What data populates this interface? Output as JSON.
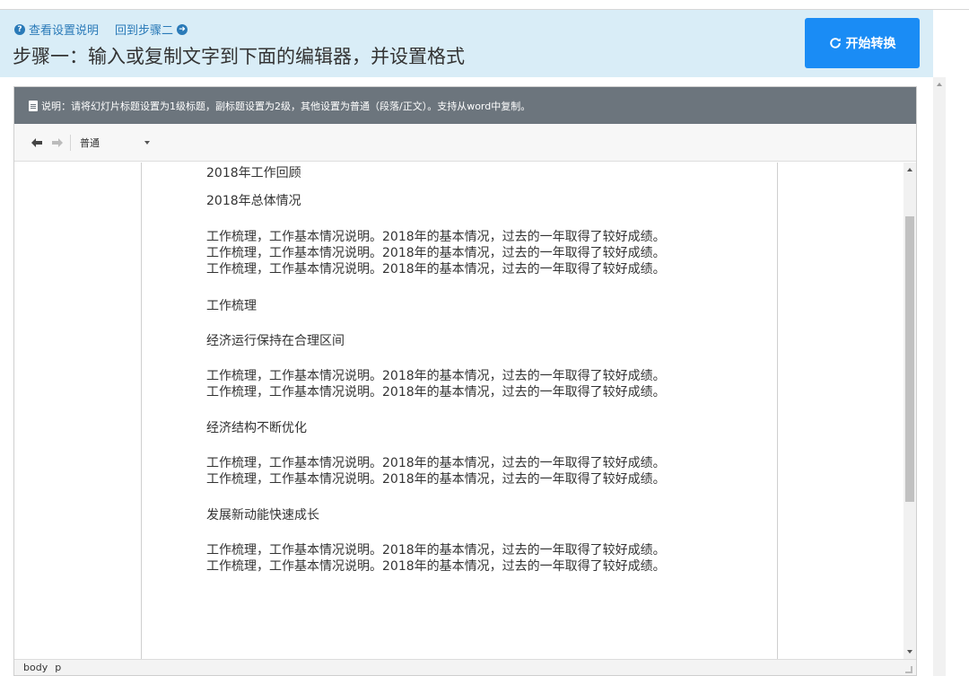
{
  "header": {
    "help_link": "查看设置说明",
    "back_link": "回到步骤二",
    "title": "步骤一：输入或复制文字到下面的编辑器，并设置格式",
    "convert_button": "开始转换",
    "background_color": "#d9edf7",
    "button_color": "#1a8cf5"
  },
  "editor": {
    "notice": "说明：请将幻灯片标题设置为1级标题，副标题设置为2级，其他设置为普通（段落/正文）。支持从word中复制。",
    "toolbar": {
      "undo_icon": "undo-icon",
      "redo_icon": "redo-icon",
      "format_select": "普通"
    },
    "content": [
      "2018年工作回顾",
      "2018年总体情况",
      "工作梳理，工作基本情况说明。2018年的基本情况，过去的一年取得了较好成绩。",
      "工作梳理，工作基本情况说明。2018年的基本情况，过去的一年取得了较好成绩。",
      "工作梳理，工作基本情况说明。2018年的基本情况，过去的一年取得了较好成绩。",
      "工作梳理",
      "经济运行保持在合理区间",
      "工作梳理，工作基本情况说明。2018年的基本情况，过去的一年取得了较好成绩。",
      "工作梳理，工作基本情况说明。2018年的基本情况，过去的一年取得了较好成绩。",
      "经济结构不断优化",
      "工作梳理，工作基本情况说明。2018年的基本情况，过去的一年取得了较好成绩。",
      "工作梳理，工作基本情况说明。2018年的基本情况，过去的一年取得了较好成绩。",
      "发展新动能快速成长",
      "工作梳理，工作基本情况说明。2018年的基本情况，过去的一年取得了较好成绩。",
      "工作梳理，工作基本情况说明。2018年的基本情况，过去的一年取得了较好成绩。"
    ],
    "statusbar": {
      "path_body": "body",
      "path_p": "p"
    }
  }
}
